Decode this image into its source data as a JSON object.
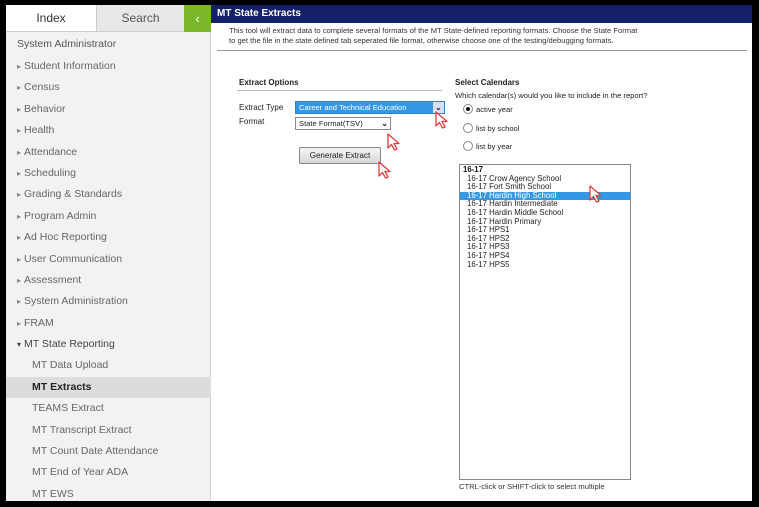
{
  "sidebar": {
    "tabs": {
      "index": "Index",
      "search": "Search",
      "collapse_icon": "chevron-left-icon"
    },
    "root": "System Administrator",
    "items": [
      "Student Information",
      "Census",
      "Behavior",
      "Health",
      "Attendance",
      "Scheduling",
      "Grading & Standards",
      "Program Admin",
      "Ad Hoc Reporting",
      "User Communication",
      "Assessment",
      "System Administration",
      "FRAM"
    ],
    "open_item": "MT State Reporting",
    "sub_items": [
      "MT Data Upload",
      "MT Extracts",
      "TEAMS Extract",
      "MT Transcript Extract",
      "MT Count Date Attendance",
      "MT End of Year ADA",
      "MT EWS"
    ],
    "active_sub_item": "MT Extracts"
  },
  "main": {
    "title": "MT State Extracts",
    "description": [
      "This tool will extract data to complete several formats of the MT State-defined reporting formats. Choose the State Format",
      "to get the file in the state defined tab seperated file format, otherwise choose one of the testing/debugging formats."
    ],
    "extract_options": {
      "title": "Extract Options",
      "extract_type_label": "Extract Type",
      "extract_type_value": "Career and Technical Education",
      "format_label": "Format",
      "format_value": "State Format(TSV)",
      "generate_label": "Generate Extract"
    },
    "calendars": {
      "title": "Select Calendars",
      "question": "Which calendar(s) would you like to include in the report?",
      "options": [
        "active year",
        "list by school",
        "list by year"
      ],
      "selected_option": "active year",
      "group": "16-17",
      "items": [
        "16-17 Crow Agency School",
        "16-17 Fort Smith School",
        "16-17 Hardin High School",
        "16-17 Hardin Intermediate",
        "16-17 Hardin Middle School",
        "16-17 Hardin Primary",
        "16-17 HPS1",
        "16-17 HPS2",
        "16-17 HPS3",
        "16-17 HPS4",
        "16-17 HPS5"
      ],
      "selected_item": "16-17 Hardin High School",
      "hint": "CTRL-click or SHIFT-click to select multiple"
    }
  },
  "colors": {
    "title_bar": "#15206b",
    "collapse_button": "#7ab829",
    "selection": "#3399e6",
    "cursor_accent": "#e23b3b"
  }
}
